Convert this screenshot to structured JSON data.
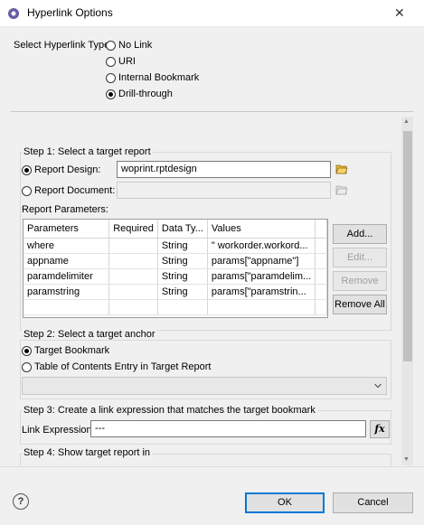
{
  "window": {
    "title": "Hyperlink Options",
    "close_glyph": "✕"
  },
  "hyperlink_type": {
    "label": "Select Hyperlink Type:",
    "options": [
      {
        "label": "No Link",
        "selected": false
      },
      {
        "label": "URI",
        "selected": false
      },
      {
        "label": "Internal Bookmark",
        "selected": false
      },
      {
        "label": "Drill-through",
        "selected": true
      }
    ]
  },
  "step1": {
    "title": "Step 1: Select a target report",
    "report_design": {
      "label": "Report Design:",
      "value": "woprint.rptdesign",
      "selected": true
    },
    "report_document": {
      "label": "Report Document:",
      "value": "",
      "selected": false
    },
    "params_label": "Report Parameters:",
    "columns": [
      "Parameters",
      "Required",
      "Data Ty...",
      "Values"
    ],
    "rows": [
      [
        "where",
        "",
        "String",
        "\" workorder.workord..."
      ],
      [
        "appname",
        "",
        "String",
        "params[\"appname\"]"
      ],
      [
        "paramdelimiter",
        "",
        "String",
        "params[\"paramdelim..."
      ],
      [
        "paramstring",
        "",
        "String",
        "params[\"paramstrin..."
      ]
    ],
    "buttons": {
      "add": "Add...",
      "edit": "Edit...",
      "remove": "Remove",
      "remove_all": "Remove All"
    }
  },
  "step2": {
    "title": "Step 2: Select a target anchor",
    "target_bookmark": {
      "label": "Target Bookmark",
      "selected": true
    },
    "toc_entry": {
      "label": "Table of Contents Entry in Target Report",
      "selected": false
    },
    "combo_value": ""
  },
  "step3": {
    "title": "Step 3: Create a link expression that matches the target bookmark",
    "expr_label": "Link Expression:",
    "expr_value": "---",
    "fx_label": "fx"
  },
  "step4": {
    "title": "Step 4: Show target report in"
  },
  "footer": {
    "ok": "OK",
    "cancel": "Cancel",
    "help": "?"
  }
}
